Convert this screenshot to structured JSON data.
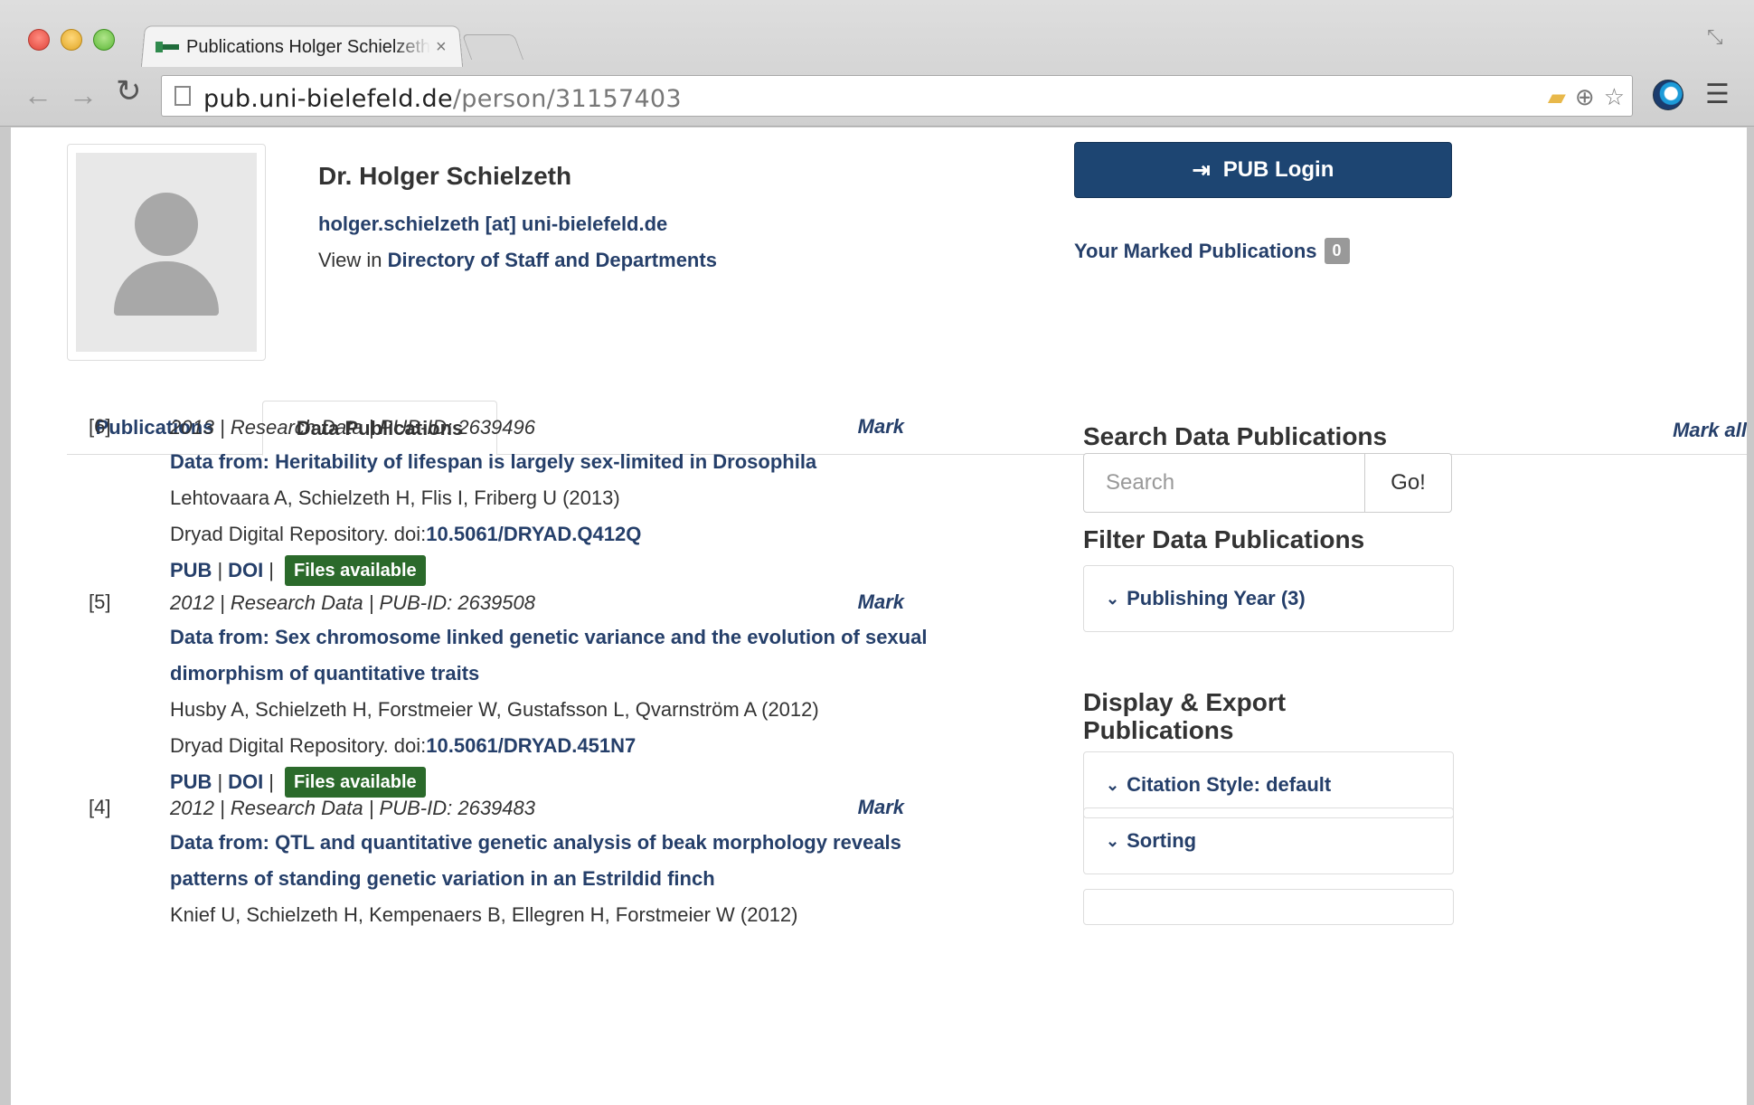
{
  "browser": {
    "tab_title": "Publications Holger Schielzeth",
    "tab_close": "×",
    "url_host": "pub.uni-bielefeld.de",
    "url_path": "/person/31157403"
  },
  "profile": {
    "name": "Dr. Holger Schielzeth",
    "email": "holger.schielzeth [at] uni-bielefeld.de",
    "view_in": "View in ",
    "directory_link": "Directory of Staff and Departments"
  },
  "account": {
    "login_label": "PUB Login",
    "marked_label": "Your Marked Publications",
    "marked_count": "0"
  },
  "tabs": [
    {
      "label": "Publications",
      "active": false
    },
    {
      "label": "Data Publications",
      "active": true
    }
  ],
  "mark_all": "Mark all",
  "publications": [
    {
      "num": "[6]",
      "meta": "2013 | Research Data | PUB-ID: 2639496",
      "mark": "Mark",
      "title": "Data from: Heritability of lifespan is largely sex-limited in Drosophila",
      "authors": "Lehtovaara A, Schielzeth H, Flis I, Friberg U (2013)",
      "source": "Dryad Digital Repository. doi:",
      "doi": "10.5061/DRYAD.Q412Q",
      "link_pub": "PUB",
      "link_doi": "DOI",
      "sep": "|",
      "files": "Files available"
    },
    {
      "num": "[5]",
      "meta": "2012 | Research Data | PUB-ID: 2639508",
      "mark": "Mark",
      "title": "Data from: Sex chromosome linked genetic variance and the evolution of sexual dimorphism of quantitative traits",
      "authors": "Husby A, Schielzeth H, Forstmeier W, Gustafsson L, Qvarnström A (2012)",
      "source": "Dryad Digital Repository. doi:",
      "doi": "10.5061/DRYAD.451N7",
      "link_pub": "PUB",
      "link_doi": "DOI",
      "sep": "|",
      "files": "Files available"
    },
    {
      "num": "[4]",
      "meta": "2012 | Research Data | PUB-ID: 2639483",
      "mark": "Mark",
      "title": "Data from: QTL and quantitative genetic analysis of beak morphology reveals patterns of standing genetic variation in an Estrildid finch",
      "authors": "Knief U, Schielzeth H, Kempenaers B, Ellegren H, Forstmeier W (2012)"
    }
  ],
  "sidebar": {
    "search_heading": "Search Data Publications",
    "search_placeholder": "Search",
    "go_label": "Go!",
    "filter_heading": "Filter Data Publications",
    "publishing_year": "Publishing Year (3)",
    "display_heading_1": "Display & Export",
    "display_heading_2": "Publications",
    "citation_style": "Citation Style: default",
    "sorting": "Sorting"
  },
  "colors": {
    "link": "#253f6a",
    "login_button": "#1d4572",
    "files_badge": "#2b6a2b",
    "count_badge": "#999999"
  }
}
